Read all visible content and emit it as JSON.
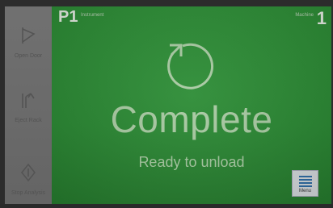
{
  "sidebar": {
    "items": [
      {
        "label": "Open Door",
        "icon": "door-icon"
      },
      {
        "label": "Eject Rack",
        "icon": "eject-rack-icon"
      },
      {
        "label": "Stop Analysis",
        "icon": "stop-diamond-icon"
      }
    ]
  },
  "header": {
    "position_label": "P1",
    "instrument_label": "Instrument",
    "machine_label": "Machine",
    "machine_number": "1"
  },
  "main": {
    "status_icon": "cycle-complete-icon",
    "status": "Complete",
    "substatus": "Ready to unload",
    "background_color": "#2b8c34"
  },
  "menu": {
    "label": "Menu",
    "icon": "menu-icon"
  }
}
